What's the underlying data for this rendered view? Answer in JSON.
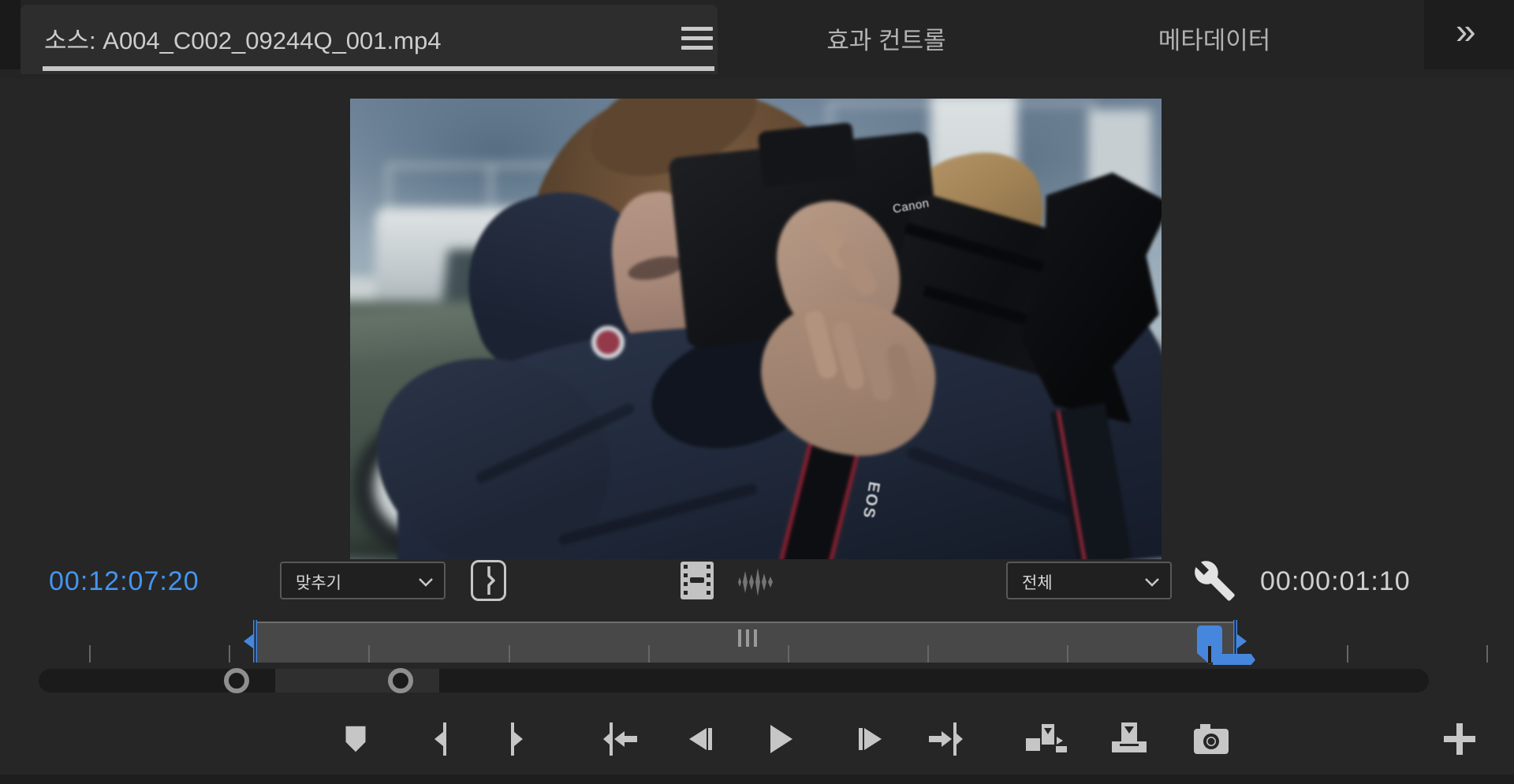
{
  "tabs": {
    "source_label": "소스: A004_C002_09244Q_001.mp4",
    "effect_controls_label": "효과 컨트롤",
    "metadata_label": "메타데이터",
    "overflow_glyph": "»"
  },
  "video": {
    "canon_logo": "Canon",
    "strap_text": "EOS",
    "scene": "Long-haired man shooting with a Canon DSLR with lens hood, navy parka, in front of a green Land Rover Defender with white roof and roof rack, overcast sky"
  },
  "controls": {
    "current_timecode": "00:12:07:20",
    "fit_dropdown_value": "맞추기",
    "resolution_dropdown_value": "전체",
    "duration_timecode": "00:00:01:10"
  },
  "colors": {
    "timecode_blue": "#4495f0",
    "playhead_blue": "#4687dd",
    "panel_bg": "#262626",
    "icon_gray": "#c6c6c6",
    "range_bar_gray": "#484848"
  }
}
